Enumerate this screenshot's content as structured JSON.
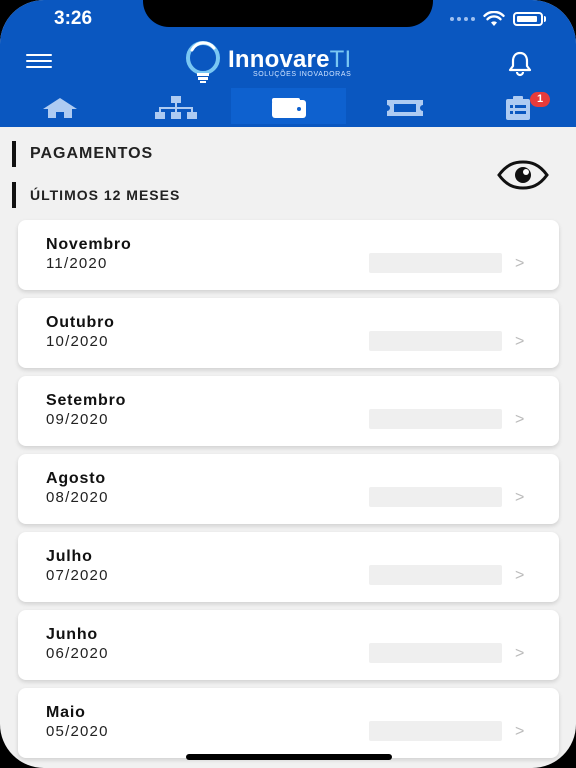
{
  "status_bar": {
    "time": "3:26"
  },
  "header": {
    "logo_name": "Innovare",
    "logo_suffix": "TI",
    "logo_tagline": "SOLUÇÕES INOVADORAS"
  },
  "tabs": [
    {
      "icon": "home-icon"
    },
    {
      "icon": "org-chart-icon"
    },
    {
      "icon": "wallet-icon",
      "active": true
    },
    {
      "icon": "ticket-icon"
    },
    {
      "icon": "clipboard-list-icon",
      "badge": "1"
    }
  ],
  "sections": {
    "payments_title": "PAGAMENTOS",
    "period_title": "ÚLTIMOS 12 MESES"
  },
  "payments": [
    {
      "month": "Novembro",
      "date": "11/2020"
    },
    {
      "month": "Outubro",
      "date": "10/2020"
    },
    {
      "month": "Setembro",
      "date": "09/2020"
    },
    {
      "month": "Agosto",
      "date": "08/2020"
    },
    {
      "month": "Julho",
      "date": "07/2020"
    },
    {
      "month": "Junho",
      "date": "06/2020"
    },
    {
      "month": "Maio",
      "date": "05/2020"
    }
  ],
  "chevron": ">",
  "colors": {
    "header_blue": "#0a57c0",
    "badge_red": "#e73b3b",
    "logo_accent": "#7ac7f3"
  }
}
